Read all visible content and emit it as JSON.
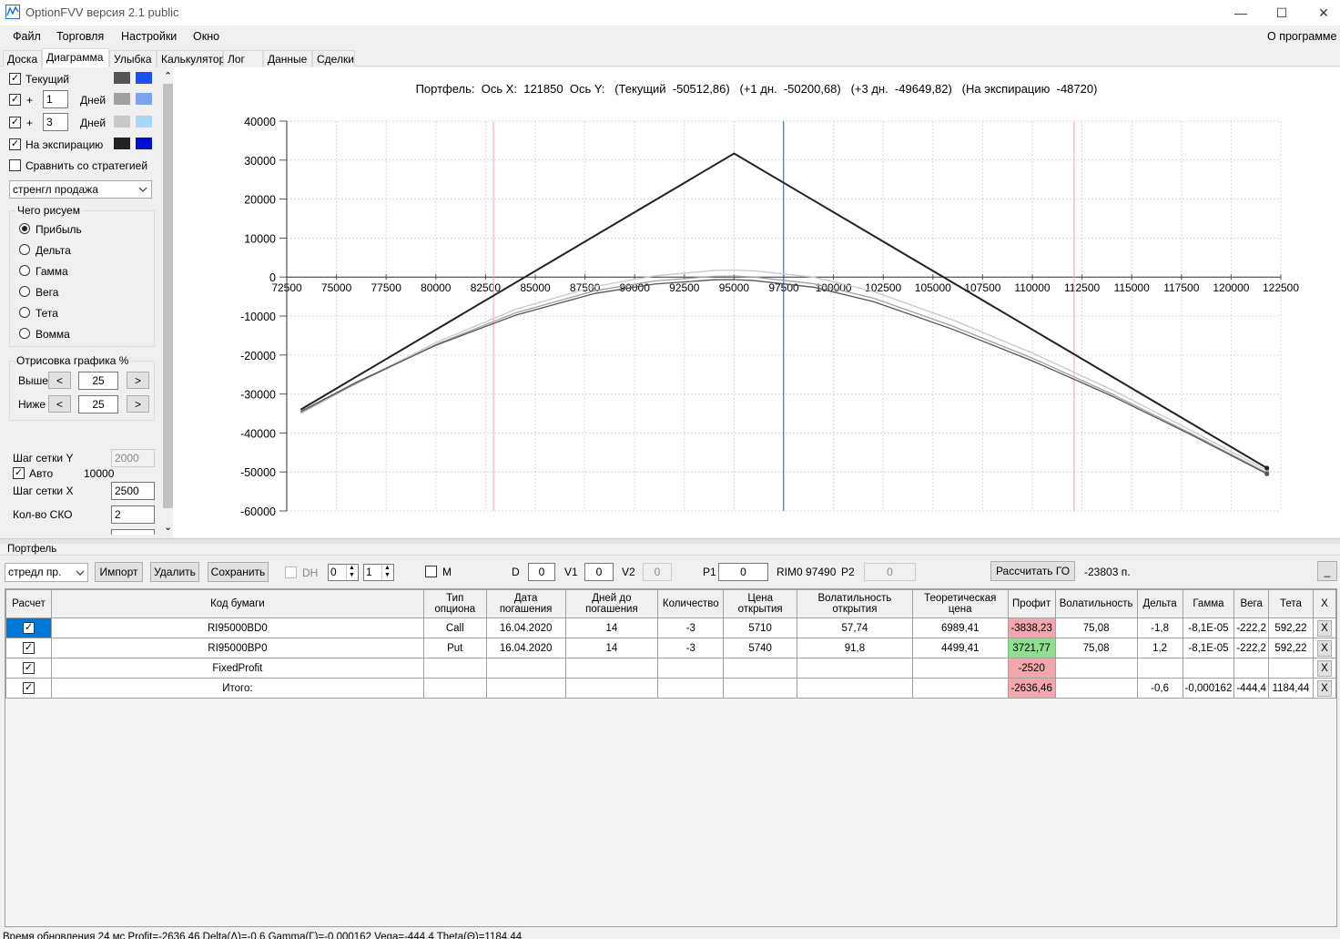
{
  "window": {
    "title": "OptionFVV версия 2.1 public",
    "minimize": "—",
    "maximize": "☐",
    "close": "✕"
  },
  "menu": {
    "items": [
      "Файл",
      "Торговля",
      "Настройки",
      "Окно"
    ],
    "about": "О программе"
  },
  "tabs": [
    "Доска",
    "Диаграмма",
    "Улыбка",
    "Калькулятор",
    "Лог",
    "Данные",
    "Сделки"
  ],
  "active_tab": "Диаграмма",
  "left_panel": {
    "current_label": "Текущий",
    "plus_sign": "+",
    "days1_value": "1",
    "days2_value": "3",
    "days_label": "Дней",
    "expiration_label": "На экспирацию",
    "compare_label": "Сравнить со стратегией",
    "strategy_select": "стренгл продажа",
    "draw_group_title": "Чего рисуем",
    "draw_options": [
      "Прибыль",
      "Дельта",
      "Гамма",
      "Вега",
      "Тета",
      "Вомма"
    ],
    "selected_draw_option": "Прибыль",
    "render_group_title": "Отрисовка графика %",
    "above_label": "Выше",
    "below_label": "Ниже",
    "above_value": "25",
    "below_value": "25",
    "dec_btn": "<",
    "inc_btn": ">",
    "grid_y_label": "Шаг сетки Y",
    "grid_y_value": "2000",
    "auto_label": "Авто",
    "auto_value": "10000",
    "grid_x_label": "Шаг сетки X",
    "grid_x_value": "2500",
    "sko_label": "Кол-во СКО",
    "sko_value": "2",
    "scroll_up": "⌃",
    "scroll_down": "⌄"
  },
  "colors": {
    "current_dark": "#555555",
    "current_light": "#1e4ff5",
    "day1_dark": "#a0a0a0",
    "day1_light": "#7aa4f0",
    "day3_dark": "#c8c8c8",
    "day3_light": "#a8d8f8",
    "exp_dark": "#222222",
    "exp_light": "#0010d0",
    "profit_negative": "#f4a6ae",
    "profit_positive": "#8ee08e",
    "selection_blue": "#0078d7"
  },
  "chart_data": {
    "type": "line",
    "title": "Портфель:  Ось X:  121850  Ось Y:   (Текущий  -50512,86)   (+1 дн.  -50200,68)   (+3 дн.  -49649,82)   (На экспирацию  -48720)",
    "xlim": [
      72500,
      122500
    ],
    "ylim": [
      -60000,
      40000
    ],
    "x_ticks": [
      "72500",
      "75000",
      "77500",
      "80000",
      "82500",
      "85000",
      "87500",
      "90000",
      "92500",
      "95000",
      "97500",
      "100000",
      "102500",
      "105000",
      "107500",
      "110000",
      "112500",
      "115000",
      "117500",
      "120000",
      "122500"
    ],
    "y_ticks": [
      "40000",
      "30000",
      "20000",
      "10000",
      "0",
      "-10000",
      "-20000",
      "-30000",
      "-40000",
      "-50000",
      "-60000"
    ],
    "grid": true,
    "vertical_markers": [
      {
        "x": 82900,
        "color": "#f4a6ae"
      },
      {
        "x": 97490,
        "color": "#3050a0"
      },
      {
        "x": 112100,
        "color": "#f4a6ae"
      }
    ],
    "series": [
      {
        "color": "#222222",
        "x": [
          73200,
          95000,
          121800
        ],
        "y": [
          -34000,
          31700,
          -49000
        ]
      },
      {
        "color": "#555555",
        "x": [
          73200,
          76000,
          80000,
          84000,
          88000,
          91000,
          94000,
          95000,
          96000,
          99000,
          102000,
          106000,
          110000,
          114000,
          118000,
          121800
        ],
        "y": [
          -34500,
          -27000,
          -17500,
          -9800,
          -4200,
          -1800,
          -700,
          -650,
          -900,
          -2600,
          -6300,
          -13400,
          -21500,
          -30500,
          -40500,
          -50500
        ]
      },
      {
        "color": "#a0a0a0",
        "x": [
          73200,
          76000,
          80000,
          84000,
          88000,
          91000,
          94000,
          95000,
          96000,
          99000,
          102000,
          106000,
          110000,
          114000,
          118000,
          121800
        ],
        "y": [
          -34800,
          -27300,
          -17300,
          -9200,
          -3500,
          -1000,
          200,
          250,
          0,
          -1700,
          -5400,
          -12600,
          -20800,
          -30000,
          -40200,
          -50200
        ]
      },
      {
        "color": "#c8c8c8",
        "x": [
          73200,
          76000,
          80000,
          84000,
          88000,
          91000,
          94000,
          95000,
          96000,
          99000,
          102000,
          106000,
          110000,
          114000,
          118000,
          121800
        ],
        "y": [
          -35000,
          -27200,
          -16800,
          -8300,
          -2400,
          300,
          1700,
          1800,
          1600,
          0,
          -3700,
          -11000,
          -19500,
          -28900,
          -39400,
          -49600
        ]
      }
    ]
  },
  "portfolio": {
    "section_title": "Портфель",
    "strategy_select": "стредл пр.",
    "import_btn": "Импорт",
    "delete_btn": "Удалить",
    "save_btn": "Сохранить",
    "dh_label": "DH",
    "spin1_value": "0",
    "spin2_value": "1",
    "m_label": "M",
    "d_label": "D",
    "d_value": "0",
    "v1_label": "V1",
    "v1_value": "0",
    "v2_label": "V2",
    "v2_value": "0",
    "p1_label": "P1",
    "p1_value": "0",
    "rim_text": "RIM0 97490",
    "p2_label": "P2",
    "p2_value": "0",
    "calc_btn": "Рассчитать ГО",
    "go_value": "-23803 п.",
    "collapse_btn": "_"
  },
  "table": {
    "headers": [
      "Расчет",
      "Код бумаги",
      "Тип опциона",
      "Дата погашения",
      "Дней до погашения",
      "Количество",
      "Цена открытия",
      "Волатильность открытия",
      "Теоретическая цена",
      "Профит",
      "Волатильность",
      "Дельта",
      "Гамма",
      "Вега",
      "Тета",
      "X"
    ],
    "rows": [
      {
        "code": "RI95000BD0",
        "type": "Call",
        "date": "16.04.2020",
        "days": "14",
        "qty": "-3",
        "price": "5710",
        "vol_open": "57,74",
        "theo": "6989,41",
        "profit": "-3838,23",
        "profit_sign": "neg",
        "vol": "75,08",
        "delta": "-1,8",
        "gamma": "-8,1E-05",
        "vega": "-222,2",
        "theta": "592,22",
        "x": "X"
      },
      {
        "code": "RI95000BP0",
        "type": "Put",
        "date": "16.04.2020",
        "days": "14",
        "qty": "-3",
        "price": "5740",
        "vol_open": "91,8",
        "theo": "4499,41",
        "profit": "3721,77",
        "profit_sign": "pos",
        "vol": "75,08",
        "delta": "1,2",
        "gamma": "-8,1E-05",
        "vega": "-222,2",
        "theta": "592,22",
        "x": "X"
      },
      {
        "code": "FixedProfit",
        "type": "",
        "date": "",
        "days": "",
        "qty": "",
        "price": "",
        "vol_open": "",
        "theo": "",
        "profit": "-2520",
        "profit_sign": "neg",
        "vol": "",
        "delta": "",
        "gamma": "",
        "vega": "",
        "theta": "",
        "x": "X"
      },
      {
        "code": "Итого:",
        "type": "",
        "date": "",
        "days": "",
        "qty": "",
        "price": "",
        "vol_open": "",
        "theo": "",
        "profit": "-2636,46",
        "profit_sign": "neg",
        "vol": "",
        "delta": "-0,6",
        "gamma": "-0,000162",
        "vega": "-444,4",
        "theta": "1184,44",
        "x": "X"
      }
    ]
  },
  "status": {
    "text": "Время обновления 24 мс  Profit=-2636,46 Delta(Δ)=-0,6 Gamma(Γ)=-0,000162 Vega=-444,4 Theta(Θ)=1184,44"
  }
}
